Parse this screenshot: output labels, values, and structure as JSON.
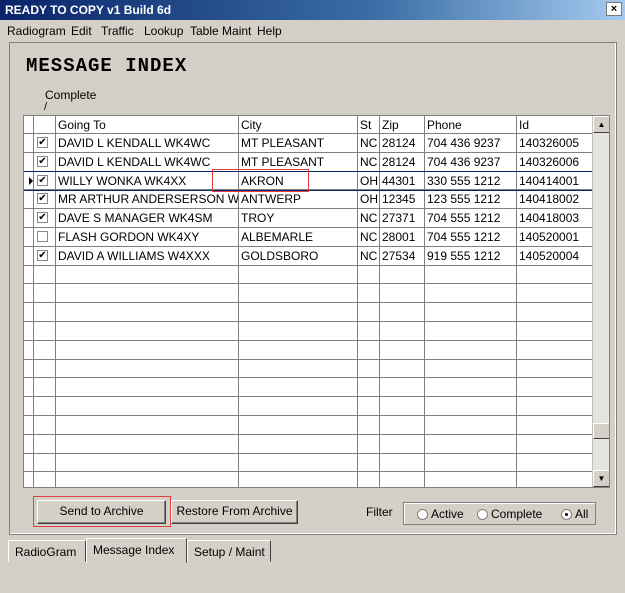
{
  "window": {
    "title": "READY TO COPY v1 Build 6d",
    "close": "×"
  },
  "menu": [
    "Radiogram",
    "Edit",
    "Traffic",
    "Lookup",
    "Table Maint",
    "Help"
  ],
  "page": {
    "heading": "MESSAGE INDEX",
    "complete_label": "Complete",
    "complete_slash": "/"
  },
  "grid": {
    "columns": [
      "Going To",
      "City",
      "St",
      "Zip",
      "Phone",
      "Id"
    ],
    "rows": [
      {
        "checked": true,
        "going_to": "DAVID L KENDALL WK4WC",
        "city": "MT PLEASANT",
        "st": "NC",
        "zip": "28124",
        "phone": "704 436 9237",
        "id": "140326005"
      },
      {
        "checked": true,
        "going_to": "DAVID L KENDALL WK4WC",
        "city": "MT PLEASANT",
        "st": "NC",
        "zip": "28124",
        "phone": "704 436 9237",
        "id": "140326006"
      },
      {
        "checked": true,
        "going_to": "WILLY WONKA WK4XX",
        "city": "AKRON",
        "st": "OH",
        "zip": "44301",
        "phone": "330 555 1212",
        "id": "140414001"
      },
      {
        "checked": true,
        "going_to": "MR ARTHUR ANDERSERSON WA",
        "city": "ANTWERP",
        "st": "OH",
        "zip": "12345",
        "phone": "123 555 1212",
        "id": "140418002"
      },
      {
        "checked": true,
        "going_to": "DAVE S MANAGER WK4SM",
        "city": "TROY",
        "st": "NC",
        "zip": "27371",
        "phone": "704 555 1212",
        "id": "140418003"
      },
      {
        "checked": false,
        "going_to": "FLASH GORDON WK4XY",
        "city": "ALBEMARLE",
        "st": "NC",
        "zip": "28001",
        "phone": "704 555 1212",
        "id": "140520001"
      },
      {
        "checked": true,
        "going_to": "DAVID A WILLIAMS W4XXX",
        "city": "GOLDSBORO",
        "st": "NC",
        "zip": "27534",
        "phone": "919 555 1212",
        "id": "140520004"
      }
    ],
    "selected_row": 2,
    "check_glyph": "✔"
  },
  "buttons": {
    "send_to_archive": "Send to Archive",
    "restore_from_archive": "Restore From Archive"
  },
  "filter": {
    "label": "Filter",
    "options": [
      "Active",
      "Complete",
      "All"
    ],
    "selected": "All"
  },
  "tabs": [
    "RadioGram",
    "Message Index",
    "Setup / Maint"
  ],
  "active_tab": "Message Index",
  "colors": {
    "titlebar": "#0a246a",
    "highlight": "#e04040",
    "selected_row_border": "#0a246a"
  }
}
